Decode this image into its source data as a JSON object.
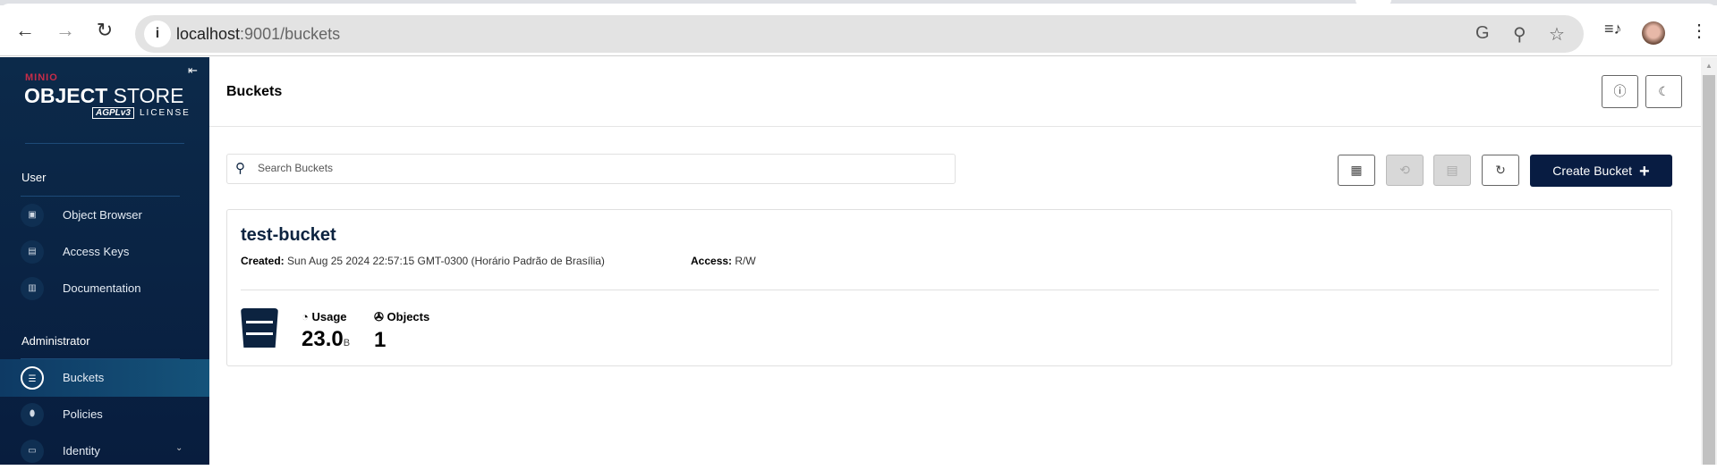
{
  "browser": {
    "url_host": "localhost",
    "url_path": ":9001/buckets"
  },
  "sidebar": {
    "brand": "MINIO",
    "product": "OBJECT",
    "product2": " STORE",
    "license_badge": "AGPLv3",
    "license": "LICENSE",
    "sections": [
      {
        "title": "User",
        "items": [
          {
            "label": "Object Browser",
            "icon": "object-browser-icon"
          },
          {
            "label": "Access Keys",
            "icon": "access-keys-icon"
          },
          {
            "label": "Documentation",
            "icon": "documentation-icon"
          }
        ]
      },
      {
        "title": "Administrator",
        "items": [
          {
            "label": "Buckets",
            "icon": "bucket-icon",
            "active": true
          },
          {
            "label": "Policies",
            "icon": "policies-icon"
          },
          {
            "label": "Identity",
            "icon": "identity-icon"
          }
        ]
      }
    ]
  },
  "main": {
    "title": "Buckets",
    "search_placeholder": "Search Buckets",
    "create_label": "Create Bucket",
    "buckets": [
      {
        "name": "test-bucket",
        "created_label": "Created:",
        "created": "Sun Aug 25 2024 22:57:15 GMT-0300 (Horário Padrão de Brasília)",
        "access_label": "Access:",
        "access": "R/W",
        "usage_label": "Usage",
        "usage_value": "23.0",
        "usage_unit": "B",
        "objects_label": "Objects",
        "objects_value": "1"
      }
    ]
  }
}
